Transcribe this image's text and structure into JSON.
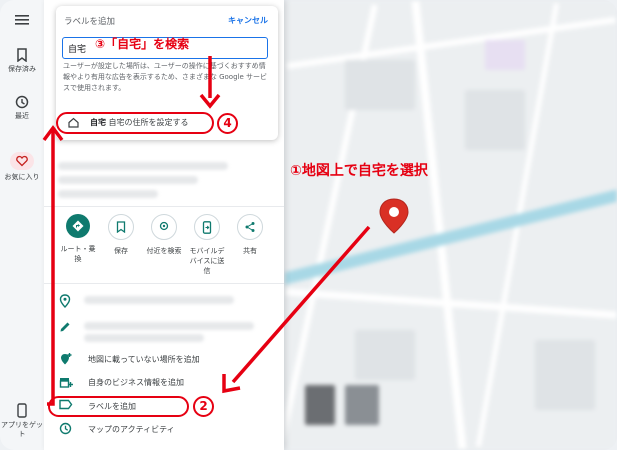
{
  "rail": {
    "items": [
      {
        "label": "保存済み",
        "icon": "bookmark-icon"
      },
      {
        "label": "最近",
        "icon": "history-icon"
      },
      {
        "label": "お気に入り",
        "icon": "heart-icon"
      },
      {
        "label": "アプリをゲット",
        "icon": "phone-icon"
      }
    ]
  },
  "label_card": {
    "title": "ラベルを追加",
    "cancel": "キャンセル",
    "search_value": "自宅",
    "description": "ユーザーが設定した場所は、ユーザーの操作に基づくおすすめ情報やより有用な広告を表示するため、さまざまな Google サービスで使用されます。",
    "result_bold": "自宅",
    "result_rest": "自宅の住所を設定する"
  },
  "actions": [
    {
      "label": "ルート・乗換",
      "icon": "directions-icon"
    },
    {
      "label": "保存",
      "icon": "bookmark-icon"
    },
    {
      "label": "付近を検索",
      "icon": "nearby-icon"
    },
    {
      "label": "モバイルデバイスに送信",
      "icon": "send-to-phone-icon"
    },
    {
      "label": "共有",
      "icon": "share-icon"
    }
  ],
  "list": {
    "add_missing_place": "地図に載っていない場所を追加",
    "add_business": "自身のビジネス情報を追加",
    "add_label": "ラベルを追加",
    "map_activity": "マップのアクティビティ"
  },
  "annotations": {
    "step1": "①地図上で自宅を選択",
    "step2": "2",
    "step3": "③「自宅」を検索",
    "step4": "4"
  },
  "colors": {
    "accent": "#1a73e8",
    "action_fill": "#0f7a6e",
    "annotation": "#e60012",
    "pin": "#d93025"
  }
}
